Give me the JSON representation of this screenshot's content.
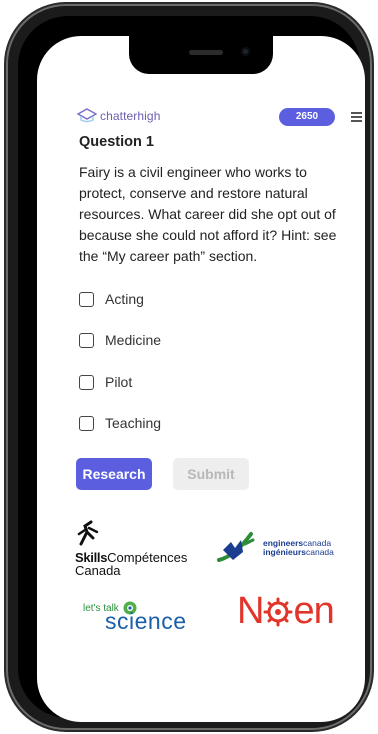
{
  "app": {
    "brand": "chatterhigh",
    "points": "2650"
  },
  "question": {
    "title": "Question 1",
    "text": "Fairy is a civil engineer who works to protect, conserve and restore natural resources. What career did she opt out of because she could not afford it? Hint: see the “My career path” section.",
    "options": [
      "Acting",
      "Medicine",
      "Pilot",
      "Teaching"
    ]
  },
  "buttons": {
    "research": "Research",
    "submit": "Submit"
  },
  "sponsors": {
    "skills_bold": "Skills",
    "skills_rest": "Compétences",
    "skills_line2": "Canada",
    "eng_line1_bold": "engineers",
    "eng_line1": "canada",
    "eng_line2_bold": "ingénieurs",
    "eng_line2": "canada",
    "lts_small": "let's talk",
    "lts_big": "science",
    "ngen_n": "N",
    "ngen_rest": "en"
  },
  "colors": {
    "accent": "#5b5fdf",
    "brand_text": "#6b5fb0",
    "ngen_red": "#e2352a",
    "lts_green": "#2c8f3a",
    "lts_blue": "#1b5fa8"
  }
}
